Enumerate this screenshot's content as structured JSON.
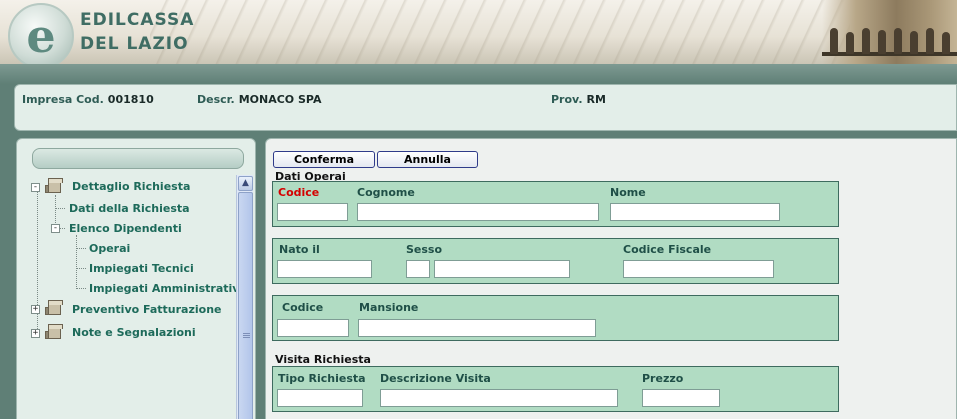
{
  "app": {
    "logo_line1": "EDILCASSA",
    "logo_line2": "DEL LAZIO",
    "logo_letter": "e"
  },
  "infobar": {
    "impresa_label": "Impresa Cod.",
    "impresa_value": "001810",
    "descr_label": "Descr.",
    "descr_value": "MONACO SPA",
    "prov_label": "Prov.",
    "prov_value": "RM"
  },
  "tree": {
    "items": [
      {
        "label": "Dettaglio Richiesta",
        "expander": "-"
      },
      {
        "label": "Dati della Richiesta"
      },
      {
        "label": "Elenco Dipendenti",
        "expander": "-"
      },
      {
        "label": "Operai"
      },
      {
        "label": "Impiegati Tecnici"
      },
      {
        "label": "Impiegati Amministrativi"
      },
      {
        "label": "Preventivo Fatturazione",
        "expander": "+"
      },
      {
        "label": "Note e Segnalazioni",
        "expander": "+"
      }
    ]
  },
  "toolbar": {
    "confirm_label": "Conferma",
    "cancel_label": "Annulla"
  },
  "form": {
    "section_operai": "Dati Operai",
    "row1": {
      "codice_label": "Codice",
      "codice_value": "",
      "cognome_label": "Cognome",
      "cognome_value": "",
      "nome_label": "Nome",
      "nome_value": ""
    },
    "row2": {
      "nato_label": "Nato il",
      "nato_value": "",
      "sesso_label": "Sesso",
      "sesso_code_value": "",
      "sesso_desc_value": "",
      "cf_label": "Codice Fiscale",
      "cf_value": ""
    },
    "row3": {
      "codice_label": "Codice",
      "codice_value": "",
      "mansione_label": "Mansione",
      "mansione_value": ""
    },
    "section_visita": "Visita Richiesta",
    "row4": {
      "tipo_label": "Tipo Richiesta",
      "tipo_value": "",
      "descr_label": "Descrizione Visita",
      "descr_value": "",
      "prezzo_label": "Prezzo",
      "prezzo_value": ""
    }
  },
  "colors": {
    "accent": "#1d6a5a",
    "required": "#d40000",
    "group_bg": "#b1dcc3"
  }
}
